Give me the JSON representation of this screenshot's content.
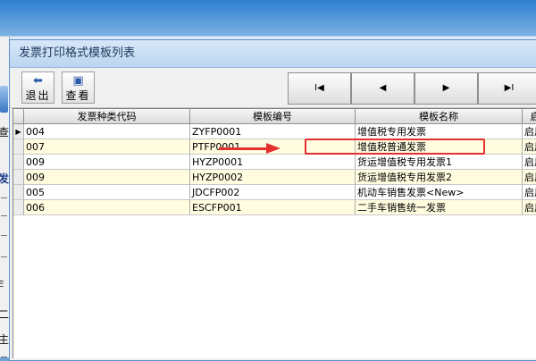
{
  "window": {
    "title": "发票打印格式模板列表"
  },
  "toolbar": {
    "exit_label": "退出",
    "view_label": "查看"
  },
  "nav": {
    "first": "I◀",
    "prev": "◀",
    "next": "▶",
    "last": "▶I"
  },
  "background": {
    "left_chars": [
      "查",
      "发",
      "E",
      "二",
      "主"
    ]
  },
  "table": {
    "headers": [
      "发票种类代码",
      "模板编号",
      "模板名称",
      "启用"
    ],
    "rows": [
      {
        "code": "004",
        "template_id": "ZYFP0001",
        "name": "增值税专用发票",
        "status": "启用"
      },
      {
        "code": "007",
        "template_id": "PTFP0001",
        "name": "增值税普通发票",
        "status": "启用"
      },
      {
        "code": "009",
        "template_id": "HYZP0001",
        "name": "货运增值税专用发票1",
        "status": "启用"
      },
      {
        "code": "009",
        "template_id": "HYZP0002",
        "name": "货运增值税专用发票2",
        "status": "启用"
      },
      {
        "code": "005",
        "template_id": "JDCFP002",
        "name": "机动车销售发票<New>",
        "status": "启用"
      },
      {
        "code": "006",
        "template_id": "ESCFP001",
        "name": "二手车销售统一发票",
        "status": "启用"
      }
    ]
  },
  "colors": {
    "annotation": "#e53030",
    "row_alt": "#fffce0",
    "title_text": "#1e395b"
  }
}
